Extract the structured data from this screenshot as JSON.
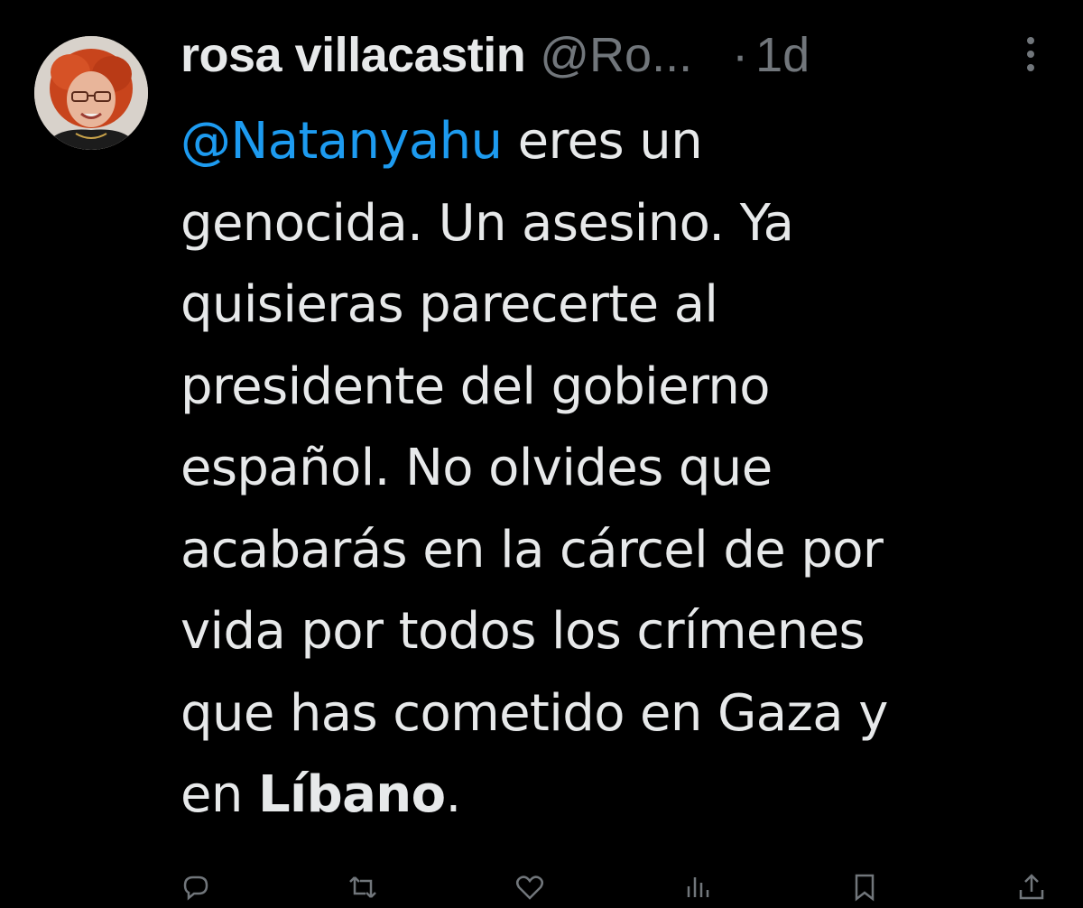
{
  "tweet": {
    "author": {
      "display_name": "rosa villacastin",
      "handle": "@Ro..."
    },
    "separator": "·",
    "time": "1d",
    "body": {
      "mention": "@Natanyahu",
      "line1_rest": " eres un",
      "line2": "genocida. Un asesino. Ya",
      "line3": "quisieras parecerte al",
      "line4": "presidente del gobierno",
      "line5": "español. No olvides que",
      "line6": "acabarás en la cárcel de por",
      "line7": "vida por todos los crímenes",
      "line8": "que has cometido en Gaza y",
      "line9_prefix": "en ",
      "line9_bold": "Líbano",
      "line9_suffix": "."
    }
  },
  "icons": {
    "more": "more-horizontal-icon",
    "reply": "reply-icon",
    "repost": "repost-icon",
    "like": "like-icon",
    "views": "views-icon",
    "bookmark": "bookmark-icon",
    "share": "share-icon"
  },
  "colors": {
    "background": "#000000",
    "text": "#e7e9ea",
    "secondary_text": "#71767b",
    "mention": "#1d9bf0"
  }
}
